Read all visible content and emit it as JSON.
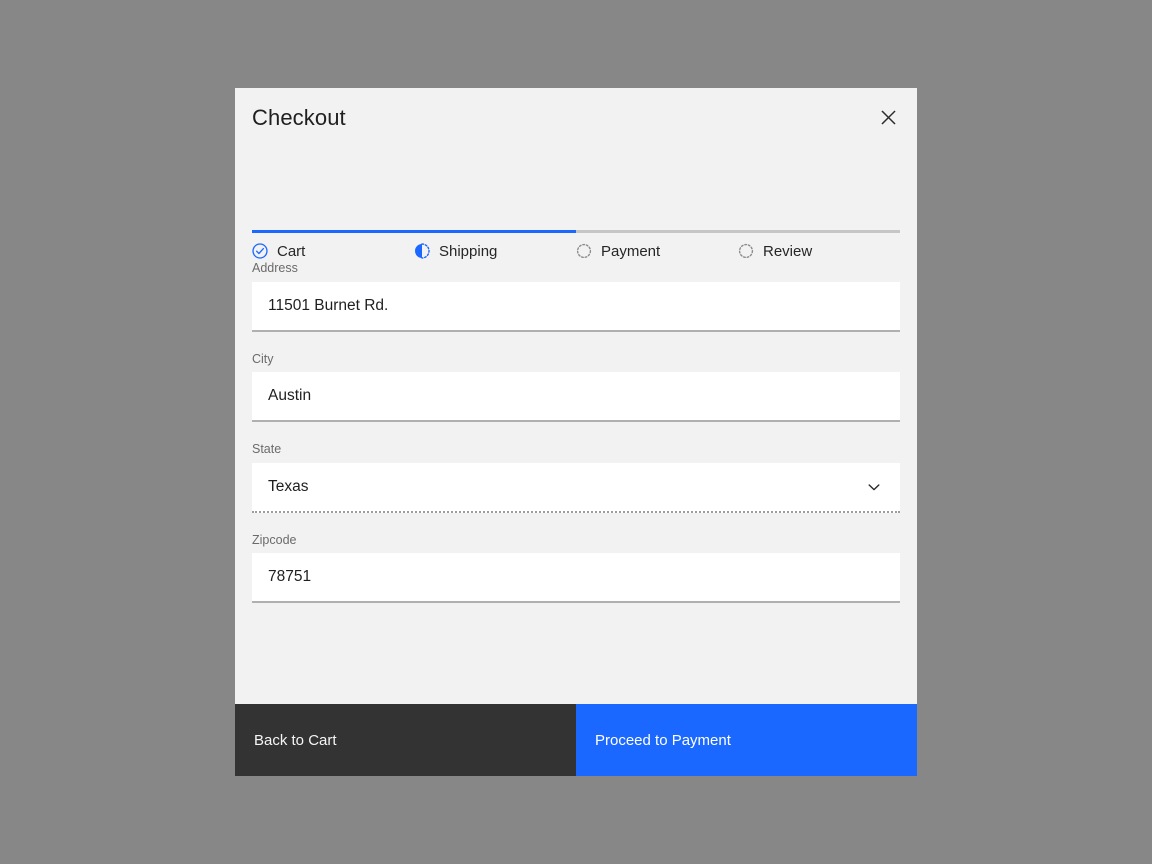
{
  "colors": {
    "page_backdrop": "#878787",
    "modal_background": "#f2f2f2",
    "accent_blue": "#1a68ff",
    "progress_remaining": "#c6c6c6",
    "back_button": "#333333",
    "input_background": "#ffffff"
  },
  "modal": {
    "title": "Checkout",
    "close_icon": "close-icon"
  },
  "stepper": {
    "progress_percent": 50,
    "steps": [
      {
        "label": "Cart",
        "icon": "check-circle-icon",
        "state": "completed"
      },
      {
        "label": "Shipping",
        "icon": "half-circle-icon",
        "state": "current"
      },
      {
        "label": "Payment",
        "icon": "dotted-circle-icon",
        "state": "upcoming"
      },
      {
        "label": "Review",
        "icon": "dotted-circle-icon",
        "state": "upcoming"
      }
    ]
  },
  "form": {
    "fields": [
      {
        "label": "Address",
        "value": "11501 Burnet Rd.",
        "type": "text",
        "placeholder": "Address"
      },
      {
        "label": "City",
        "value": "Austin",
        "type": "text",
        "placeholder": "City"
      },
      {
        "label": "State",
        "value": "Texas",
        "type": "select",
        "placeholder": "State",
        "icon": "chevron-down-icon"
      },
      {
        "label": "Zipcode",
        "value": "78751",
        "type": "text",
        "placeholder": "Zipcode"
      }
    ]
  },
  "footer": {
    "back_label": "Back to Cart",
    "proceed_label": "Proceed to Payment"
  }
}
